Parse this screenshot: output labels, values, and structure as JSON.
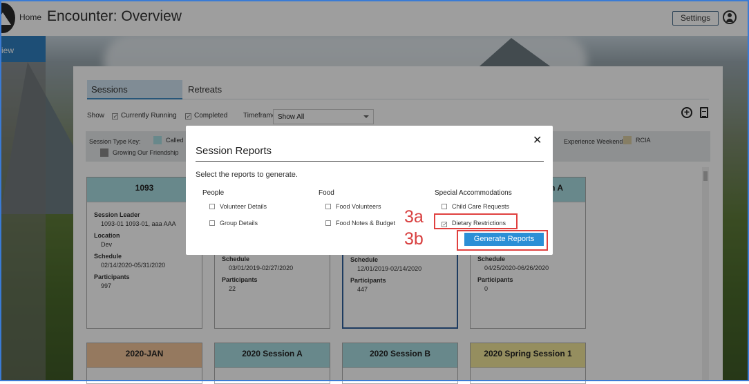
{
  "header": {
    "home_label": "Home",
    "title": "Encounter: Overview",
    "settings_label": "Settings"
  },
  "leftnav": {
    "active_label": "iew"
  },
  "tabs": [
    {
      "label": "Sessions",
      "active": true
    },
    {
      "label": "Retreats",
      "active": false
    }
  ],
  "filters": {
    "show_label": "Show",
    "currently_running": {
      "label": "Currently Running",
      "checked": true
    },
    "completed": {
      "label": "Completed",
      "checked": true
    },
    "timeframe_label": "Timeframe",
    "timeframe_value": "Show All"
  },
  "session_key": {
    "label": "Session Type Key:",
    "items": [
      {
        "label": "Called",
        "color": "#a8dbe0"
      },
      {
        "label": "Experience Weekend",
        "color": "#cfe3ea"
      },
      {
        "label": "RCIA",
        "color": "#d8cba2"
      },
      {
        "label": "Growing Our Friendship",
        "color": "#8a8a8a"
      }
    ]
  },
  "cards_row1": [
    {
      "title": "1093",
      "color": "#a8dbe0",
      "leader_label": "Session Leader",
      "leader": "1093-01 1093-01, aaa AAA",
      "location_label": "Location",
      "location": "Dev",
      "schedule_label": "Schedule",
      "schedule": "02/14/2020-05/31/2020",
      "participants_label": "Participants",
      "participants": "997"
    },
    {
      "title": "",
      "color": "#a8dbe0",
      "schedule_label": "Schedule",
      "schedule": "03/01/2019-02/27/2020",
      "participants_label": "Participants",
      "participants": "22"
    },
    {
      "title": "",
      "color": "#a8dbe0",
      "schedule_label": "Schedule",
      "schedule": "12/01/2019-02/14/2020",
      "participants_label": "Participants",
      "participants": "447"
    },
    {
      "title": "n A",
      "color": "#a8dbe0",
      "schedule_label": "Schedule",
      "schedule": "04/25/2020-06/26/2020",
      "participants_label": "Participants",
      "participants": "0"
    }
  ],
  "cards_row2": [
    {
      "title": "2020-JAN",
      "color": "#f0c49a"
    },
    {
      "title": "2020 Session A",
      "color": "#a8dbe0"
    },
    {
      "title": "2020 Session B",
      "color": "#a8dbe0"
    },
    {
      "title": "2020 Spring Session 1",
      "color": "#f0e59a"
    }
  ],
  "modal": {
    "title": "Session Reports",
    "close_glyph": "✕",
    "subtitle": "Select the reports to generate.",
    "columns": [
      {
        "heading": "People",
        "options": [
          {
            "label": "Volunteer Details",
            "checked": false
          },
          {
            "label": "Group Details",
            "checked": false
          }
        ]
      },
      {
        "heading": "Food",
        "options": [
          {
            "label": "Food Volunteers",
            "checked": false
          },
          {
            "label": "Food Notes & Budget",
            "checked": false
          }
        ]
      },
      {
        "heading": "Special Accommodations",
        "options": [
          {
            "label": "Child Care Requests",
            "checked": false
          },
          {
            "label": "Dietary Restrictions",
            "checked": true
          }
        ]
      }
    ],
    "generate_label": "Generate Reports"
  },
  "annotations": {
    "step_a": "3a",
    "step_b": "3b"
  },
  "icons": {
    "add": "plus-circle-icon",
    "doc": "document-icon",
    "user": "user-circle-icon"
  }
}
